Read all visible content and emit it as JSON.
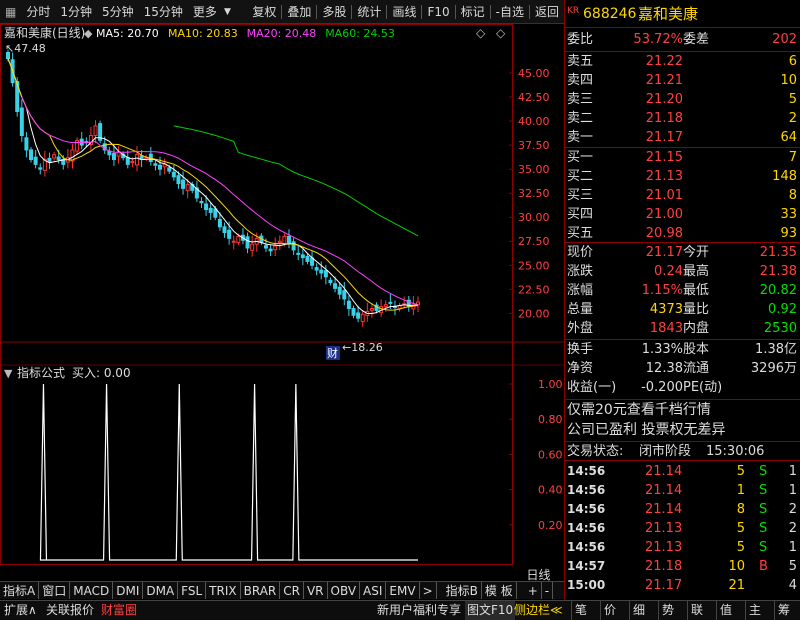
{
  "toolbar": {
    "left_icon": "grid-icon",
    "items": [
      "分时",
      "1分钟",
      "5分钟",
      "15分钟",
      "更多"
    ],
    "right_items": [
      "复权",
      "叠加",
      "多股",
      "统计",
      "画线",
      "F10",
      "标记",
      "-自选",
      "返回"
    ]
  },
  "chart": {
    "title": "嘉和美康(日线)",
    "ma": [
      {
        "label": "MA5: 20.70",
        "color": "#ffffff"
      },
      {
        "label": "MA10: 20.83",
        "color": "#ffd700"
      },
      {
        "label": "MA20: 20.48",
        "color": "#ff40ff"
      },
      {
        "label": "MA60: 24.53",
        "color": "#00d000"
      }
    ],
    "y_ticks": [
      "45.00",
      "42.50",
      "40.00",
      "37.50",
      "35.00",
      "32.50",
      "30.00",
      "27.50",
      "25.00",
      "22.50",
      "20.00"
    ],
    "high_label": "47.48",
    "low_label": "18.26",
    "cai_label": "财",
    "indicator_title": "指标公式",
    "indicator_value": "买入: 0.00",
    "ind_ticks": [
      "1.00",
      "0.80",
      "0.60",
      "0.40",
      "0.20"
    ],
    "x_labels": [
      "2021年",
      "1",
      "2",
      "3",
      "4",
      "5"
    ],
    "x_right": "日线"
  },
  "chart_data": {
    "type": "candlestick",
    "title": "嘉和美康(日线)",
    "y_range": [
      18.0,
      47.5
    ],
    "closes": [
      46.5,
      44,
      41,
      38.5,
      37,
      36,
      35.5,
      35,
      36,
      35.8,
      36.5,
      36,
      35.5,
      36.2,
      37,
      38,
      37.5,
      37.8,
      38.5,
      39.5,
      38,
      37,
      36.5,
      36,
      36.8,
      36.2,
      35.5,
      35.8,
      36.5,
      36,
      36.2,
      35.8,
      35.4,
      35,
      35.5,
      34.8,
      34.2,
      33.5,
      33,
      33.4,
      32.8,
      32,
      31.5,
      30.8,
      30.5,
      30,
      29,
      28.4,
      27.8,
      27.5,
      28,
      27.6,
      26.8,
      27.2,
      27.8,
      27.4,
      26.8,
      26.5,
      27,
      27.5,
      28,
      27.2,
      26.6,
      26.2,
      25.8,
      25.4,
      25,
      24.5,
      24.2,
      23.8,
      23.2,
      22.6,
      22,
      21.5,
      20.5,
      19.8,
      19.5,
      19.9,
      20.2,
      20.5,
      20.3,
      20.7,
      20.9,
      21.1,
      20.6,
      20.8,
      21.0,
      20.7,
      20.9,
      21.17
    ],
    "ma_series": [
      "MA5",
      "MA10",
      "MA20",
      "MA60"
    ],
    "buy_signal_bars": [
      9,
      24,
      40,
      57,
      69
    ]
  },
  "quote": {
    "code_prefix": "KR",
    "code": "688246",
    "name": "嘉和美康",
    "weibi_label": "委比",
    "weibi": "53.72%",
    "weicha_label": "委差",
    "weicha": "202",
    "asks": [
      {
        "label": "卖五",
        "price": "21.22",
        "vol": "6"
      },
      {
        "label": "卖四",
        "price": "21.21",
        "vol": "10"
      },
      {
        "label": "卖三",
        "price": "21.20",
        "vol": "5"
      },
      {
        "label": "卖二",
        "price": "21.18",
        "vol": "2"
      },
      {
        "label": "卖一",
        "price": "21.17",
        "vol": "64"
      }
    ],
    "bids": [
      {
        "label": "买一",
        "price": "21.15",
        "vol": "7"
      },
      {
        "label": "买二",
        "price": "21.13",
        "vol": "148"
      },
      {
        "label": "买三",
        "price": "21.01",
        "vol": "8"
      },
      {
        "label": "买四",
        "price": "21.00",
        "vol": "33"
      },
      {
        "label": "买五",
        "price": "20.98",
        "vol": "93"
      }
    ],
    "stats": [
      {
        "l1": "现价",
        "v1": "21.17",
        "c1": "#ff4040",
        "l2": "今开",
        "v2": "21.35",
        "c2": "#ff4040"
      },
      {
        "l1": "涨跌",
        "v1": "0.24",
        "c1": "#ff4040",
        "l2": "最高",
        "v2": "21.38",
        "c2": "#ff4040"
      },
      {
        "l1": "涨幅",
        "v1": "1.15%",
        "c1": "#ff4040",
        "l2": "最低",
        "v2": "20.82",
        "c2": "#00e000"
      },
      {
        "l1": "总量",
        "v1": "4373",
        "c1": "#ffd700",
        "l2": "量比",
        "v2": "0.92",
        "c2": "#00e000"
      },
      {
        "l1": "外盘",
        "v1": "1843",
        "c1": "#ff4040",
        "l2": "内盘",
        "v2": "2530",
        "c2": "#00e000"
      }
    ],
    "stats2": [
      {
        "l1": "换手",
        "v1": "1.33%",
        "l2": "股本",
        "v2": "1.38亿"
      },
      {
        "l1": "净资",
        "v1": "12.38",
        "l2": "流通",
        "v2": "3296万"
      },
      {
        "l1": "收益(一)",
        "v1": "-0.200",
        "l2": "PE(动)",
        "v2": ""
      }
    ],
    "notice1": "仅需20元查看千档行情",
    "notice2": "公司已盈利 投票权无差异",
    "status_label": "交易状态:",
    "status_value": "闭市阶段",
    "status_time": "15:30:06",
    "ticks": [
      {
        "t": "14:56",
        "p": "21.14",
        "v": "5",
        "bs": "S",
        "n": "1"
      },
      {
        "t": "14:56",
        "p": "21.14",
        "v": "1",
        "bs": "S",
        "n": "1"
      },
      {
        "t": "14:56",
        "p": "21.14",
        "v": "8",
        "bs": "S",
        "n": "2"
      },
      {
        "t": "14:56",
        "p": "21.13",
        "v": "5",
        "bs": "S",
        "n": "2"
      },
      {
        "t": "14:56",
        "p": "21.13",
        "v": "5",
        "bs": "S",
        "n": "1"
      },
      {
        "t": "14:57",
        "p": "21.18",
        "v": "10",
        "bs": "B",
        "n": "5"
      },
      {
        "t": "15:00",
        "p": "21.17",
        "v": "21",
        "bs": "",
        "n": "4"
      }
    ]
  },
  "bottom1": [
    "指标A",
    "窗口",
    "MACD",
    "DMI",
    "DMA",
    "FSL",
    "TRIX",
    "BRAR",
    "CR",
    "VR",
    "OBV",
    "ASI",
    "EMV",
    ">",
    "指标B",
    "模 板",
    "+",
    "-"
  ],
  "bottom2": {
    "left": [
      "扩展∧",
      "关联报价",
      "财富圈"
    ],
    "mid": "新用户福利专享",
    "f10": "图文F10",
    "side": "侧边栏≪",
    "right": [
      "笔",
      "价",
      "细",
      "势",
      "联",
      "值",
      "主",
      "筹"
    ]
  }
}
